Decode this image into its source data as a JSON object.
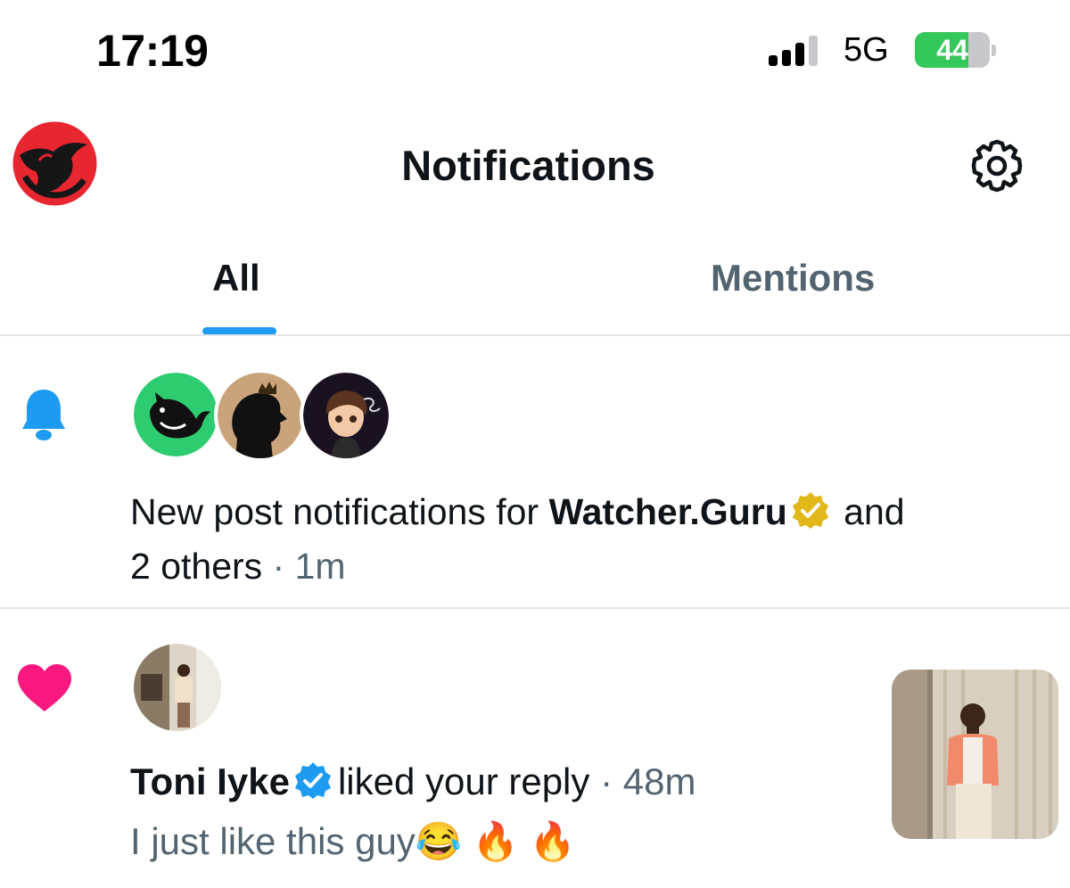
{
  "status_bar": {
    "time": "17:19",
    "network": "5G",
    "battery": "44"
  },
  "header": {
    "title": "Notifications",
    "profile_icon": "bull-logo-icon",
    "settings_icon": "gear-icon"
  },
  "tabs": [
    {
      "label": "All",
      "selected": true
    },
    {
      "label": "Mentions",
      "selected": false
    }
  ],
  "notifications": [
    {
      "type": "new-post",
      "icon": "bell-icon",
      "text_prefix": "New post notifications for ",
      "account": "Watcher.Guru",
      "text_suffix": " and",
      "line2": "2 others",
      "separator": " · ",
      "time": "1m"
    },
    {
      "type": "like",
      "icon": "heart-icon",
      "user": "Toni Iyke",
      "action": "liked your reply",
      "separator": " · ",
      "time": "48m",
      "reply": "I just like this guy😂 🔥 🔥"
    }
  ],
  "colors": {
    "accent": "#1d9bf0",
    "like": "#f91880",
    "muted": "#536471",
    "gold": "#e2b719",
    "brand_red": "#e8262f"
  }
}
